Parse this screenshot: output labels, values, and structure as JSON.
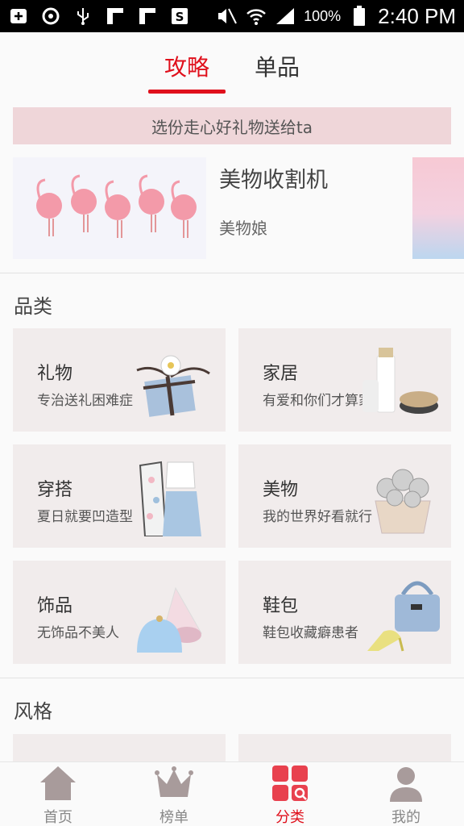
{
  "status_bar": {
    "battery_percent": "100%",
    "time": "2:40 PM",
    "icons": [
      "add-box-icon",
      "sync-icon",
      "usb-icon",
      "notification-icon",
      "notification-icon",
      "s-app-icon",
      "mute-icon",
      "wifi-icon",
      "signal-icon",
      "battery-icon"
    ]
  },
  "tabs": [
    {
      "label": "攻略",
      "active": true
    },
    {
      "label": "单品",
      "active": false
    }
  ],
  "banner": {
    "text": "选份走心好礼物送给ta"
  },
  "article": {
    "title": "美物收割机",
    "author": "美物娘"
  },
  "categories_section": {
    "title": "品类",
    "items": [
      {
        "name": "礼物",
        "desc": "专治送礼困难症",
        "icon": "gift-box-icon"
      },
      {
        "name": "家居",
        "desc": "有爱和你们才算家",
        "icon": "home-decor-icon"
      },
      {
        "name": "穿搭",
        "desc": "夏日就要凹造型",
        "icon": "outfit-icon"
      },
      {
        "name": "美物",
        "desc": "我的世界好看就行",
        "icon": "flower-bouquet-icon"
      },
      {
        "name": "饰品",
        "desc": "无饰品不美人",
        "icon": "accessory-icon"
      },
      {
        "name": "鞋包",
        "desc": "鞋包收藏癖患者",
        "icon": "shoes-bag-icon"
      }
    ]
  },
  "style_section": {
    "title": "风格"
  },
  "bottom_nav": [
    {
      "label": "首页",
      "icon": "home-icon",
      "active": false
    },
    {
      "label": "榜单",
      "icon": "crown-icon",
      "active": false
    },
    {
      "label": "分类",
      "icon": "category-grid-icon",
      "active": true
    },
    {
      "label": "我的",
      "icon": "profile-icon",
      "active": false
    }
  ],
  "colors": {
    "accent": "#e0101c",
    "banner_bg": "#efd6d9",
    "card_bg": "#f1ecec"
  }
}
